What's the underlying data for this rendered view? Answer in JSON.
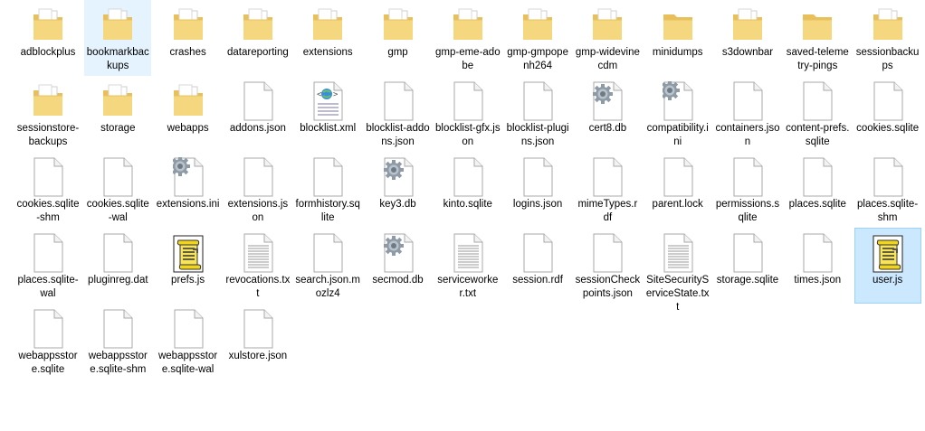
{
  "items": [
    {
      "name": "adblockplus",
      "type": "folder"
    },
    {
      "name": "bookmarkbackups",
      "type": "folder",
      "state": "hover"
    },
    {
      "name": "crashes",
      "type": "folder"
    },
    {
      "name": "datareporting",
      "type": "folder"
    },
    {
      "name": "extensions",
      "type": "folder"
    },
    {
      "name": "gmp",
      "type": "folder"
    },
    {
      "name": "gmp-eme-adobe",
      "type": "folder"
    },
    {
      "name": "gmp-gmpopenh264",
      "type": "folder"
    },
    {
      "name": "gmp-widevinecdm",
      "type": "folder"
    },
    {
      "name": "minidumps",
      "type": "folder-empty"
    },
    {
      "name": "s3downbar",
      "type": "folder"
    },
    {
      "name": "saved-telemetry-pings",
      "type": "folder-empty"
    },
    {
      "name": "sessionbackups",
      "type": "folder"
    },
    {
      "name": "sessionstore-backups",
      "type": "folder"
    },
    {
      "name": "storage",
      "type": "folder"
    },
    {
      "name": "webapps",
      "type": "folder"
    },
    {
      "name": "addons.json",
      "type": "file"
    },
    {
      "name": "blocklist.xml",
      "type": "xml"
    },
    {
      "name": "blocklist-addons.json",
      "type": "file"
    },
    {
      "name": "blocklist-gfx.json",
      "type": "file"
    },
    {
      "name": "blocklist-plugins.json",
      "type": "file"
    },
    {
      "name": "cert8.db",
      "type": "gear"
    },
    {
      "name": "compatibility.ini",
      "type": "ini"
    },
    {
      "name": "containers.json",
      "type": "file"
    },
    {
      "name": "content-prefs.sqlite",
      "type": "file"
    },
    {
      "name": "cookies.sqlite",
      "type": "file"
    },
    {
      "name": "cookies.sqlite-shm",
      "type": "file"
    },
    {
      "name": "cookies.sqlite-wal",
      "type": "file"
    },
    {
      "name": "extensions.ini",
      "type": "ini"
    },
    {
      "name": "extensions.json",
      "type": "file"
    },
    {
      "name": "formhistory.sqlite",
      "type": "file"
    },
    {
      "name": "key3.db",
      "type": "gear"
    },
    {
      "name": "kinto.sqlite",
      "type": "file"
    },
    {
      "name": "logins.json",
      "type": "file"
    },
    {
      "name": "mimeTypes.rdf",
      "type": "file"
    },
    {
      "name": "parent.lock",
      "type": "file"
    },
    {
      "name": "permissions.sqlite",
      "type": "file"
    },
    {
      "name": "places.sqlite",
      "type": "file"
    },
    {
      "name": "places.sqlite-shm",
      "type": "file"
    },
    {
      "name": "places.sqlite-wal",
      "type": "file"
    },
    {
      "name": "pluginreg.dat",
      "type": "file"
    },
    {
      "name": "prefs.js",
      "type": "js"
    },
    {
      "name": "revocations.txt",
      "type": "txt"
    },
    {
      "name": "search.json.mozlz4",
      "type": "file"
    },
    {
      "name": "secmod.db",
      "type": "gear"
    },
    {
      "name": "serviceworker.txt",
      "type": "txt"
    },
    {
      "name": "session.rdf",
      "type": "file"
    },
    {
      "name": "sessionCheckpoints.json",
      "type": "file"
    },
    {
      "name": "SiteSecurityServiceState.txt",
      "type": "txt"
    },
    {
      "name": "storage.sqlite",
      "type": "file"
    },
    {
      "name": "times.json",
      "type": "file"
    },
    {
      "name": "user.js",
      "type": "js",
      "state": "selected"
    },
    {
      "name": "webappsstore.sqlite",
      "type": "file"
    },
    {
      "name": "webappsstore.sqlite-shm",
      "type": "file"
    },
    {
      "name": "webappsstore.sqlite-wal",
      "type": "file"
    },
    {
      "name": "xulstore.json",
      "type": "file"
    }
  ]
}
